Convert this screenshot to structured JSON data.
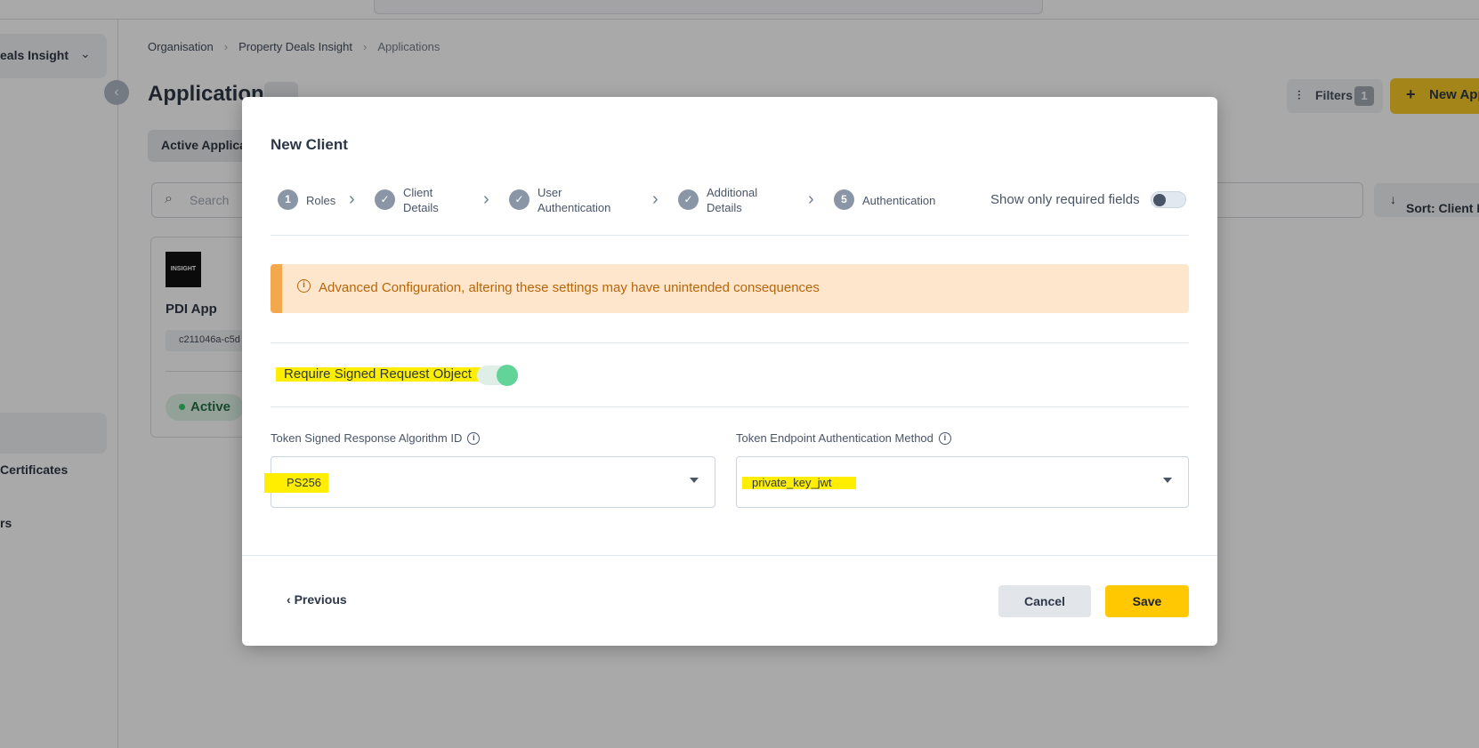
{
  "background": {
    "org_selector": {
      "label": "eals Insight"
    },
    "breadcrumb": [
      "Organisation",
      "Property Deals Insight",
      "Applications"
    ],
    "page_title": "Applications",
    "filters": {
      "label": "Filters",
      "count": "1"
    },
    "new_app": {
      "label": "New App"
    },
    "tab_active": "Active Applicat",
    "search": {
      "placeholder": "Search"
    },
    "sort": {
      "label": "Sort: Client Na"
    },
    "sidebar_items": [
      "Certificates",
      "rs"
    ],
    "card": {
      "logo_text": "INSIGHT",
      "name": "PDI App",
      "client_id": "c211046a-c5d",
      "status": "Active"
    }
  },
  "modal": {
    "title": "New Client",
    "steps": [
      {
        "marker": "1",
        "label": "Roles",
        "state": "current"
      },
      {
        "marker": "✓",
        "label_line1": "Client",
        "label_line2": "Details",
        "state": "done"
      },
      {
        "marker": "✓",
        "label_line1": "User",
        "label_line2": "Authentication",
        "state": "done"
      },
      {
        "marker": "✓",
        "label_line1": "Additional",
        "label_line2": "Details",
        "state": "done"
      },
      {
        "marker": "5",
        "label": "Authentication",
        "state": "current"
      }
    ],
    "show_required": {
      "label": "Show only required fields",
      "enabled": false
    },
    "alert": {
      "text": "Advanced Configuration, altering these settings may have unintended consequences",
      "color": "#b7660a",
      "background": "#fee6cc"
    },
    "require_signed_request": {
      "label": "Require Signed Request Object",
      "enabled": true
    },
    "token_signed_alg": {
      "label": "Token Signed Response Algorithm ID",
      "value": "PS256"
    },
    "token_endpoint_auth": {
      "label": "Token Endpoint Authentication Method",
      "value": "private_key_jwt"
    },
    "buttons": {
      "previous": "Previous",
      "cancel": "Cancel",
      "save": "Save"
    }
  },
  "colors": {
    "accent": "#ffc800",
    "highlight": "#ffee00",
    "toggle_on": "#62d49a"
  }
}
